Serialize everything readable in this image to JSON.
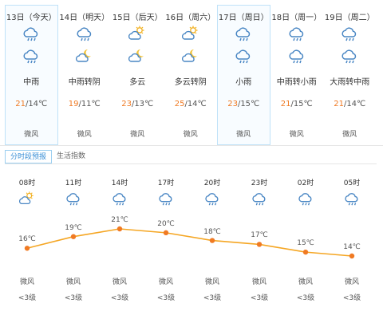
{
  "days": [
    {
      "date": "13日（今天）",
      "icon1": "rain-cloud",
      "icon2": "rain-cloud",
      "desc": "中雨",
      "hi": "21",
      "lo": "/14℃",
      "wind": "微风",
      "selected": true
    },
    {
      "date": "14日（明天）",
      "icon1": "rain-cloud",
      "icon2": "moon-cloud",
      "desc": "中雨转阴",
      "hi": "19",
      "lo": "/11℃",
      "wind": "微风",
      "selected": false
    },
    {
      "date": "15日（后天）",
      "icon1": "sun-cloud",
      "icon2": "moon-cloud",
      "desc": "多云",
      "hi": "23",
      "lo": "/13℃",
      "wind": "微风",
      "selected": false
    },
    {
      "date": "16日（周六）",
      "icon1": "sun-cloud",
      "icon2": "moon-cloud",
      "desc": "多云转阴",
      "hi": "25",
      "lo": "/14℃",
      "wind": "微风",
      "selected": false
    },
    {
      "date": "17日（周日）",
      "icon1": "rain-cloud",
      "icon2": "rain-cloud",
      "desc": "小雨",
      "hi": "23",
      "lo": "/15℃",
      "wind": "微风",
      "selected": true
    },
    {
      "date": "18日（周一）",
      "icon1": "rain-cloud",
      "icon2": "rain-cloud",
      "desc": "中雨转小雨",
      "hi": "21",
      "lo": "/15℃",
      "wind": "微风",
      "selected": false
    },
    {
      "date": "19日（周二）",
      "icon1": "rain-cloud",
      "icon2": "rain-cloud",
      "desc": "大雨转中雨",
      "hi": "21",
      "lo": "/14℃",
      "wind": "微风",
      "selected": false
    }
  ],
  "tabs": [
    "分时段预报",
    "生活指数"
  ],
  "hourly": [
    {
      "time": "08时",
      "icon": "sun-cloud",
      "temp": "16℃",
      "wind": "微风",
      "level": "<3级"
    },
    {
      "time": "11时",
      "icon": "rain-cloud",
      "temp": "19℃",
      "wind": "微风",
      "level": "<3级"
    },
    {
      "time": "14时",
      "icon": "rain-cloud",
      "temp": "21℃",
      "wind": "微风",
      "level": "<3级"
    },
    {
      "time": "17时",
      "icon": "rain-cloud",
      "temp": "20℃",
      "wind": "微风",
      "level": "<3级"
    },
    {
      "time": "20时",
      "icon": "rain-cloud",
      "temp": "18℃",
      "wind": "微风",
      "level": "<3级"
    },
    {
      "time": "23时",
      "icon": "rain-cloud",
      "temp": "17℃",
      "wind": "微风",
      "level": "<3级"
    },
    {
      "time": "02时",
      "icon": "rain-cloud",
      "temp": "15℃",
      "wind": "微风",
      "level": "<3级"
    },
    {
      "time": "05时",
      "icon": "rain-cloud",
      "temp": "14℃",
      "wind": "微风",
      "level": "<3级"
    }
  ],
  "colors": {
    "line": "#f5a623",
    "dot": "#f07a23",
    "icon": "#4a87c4"
  }
}
